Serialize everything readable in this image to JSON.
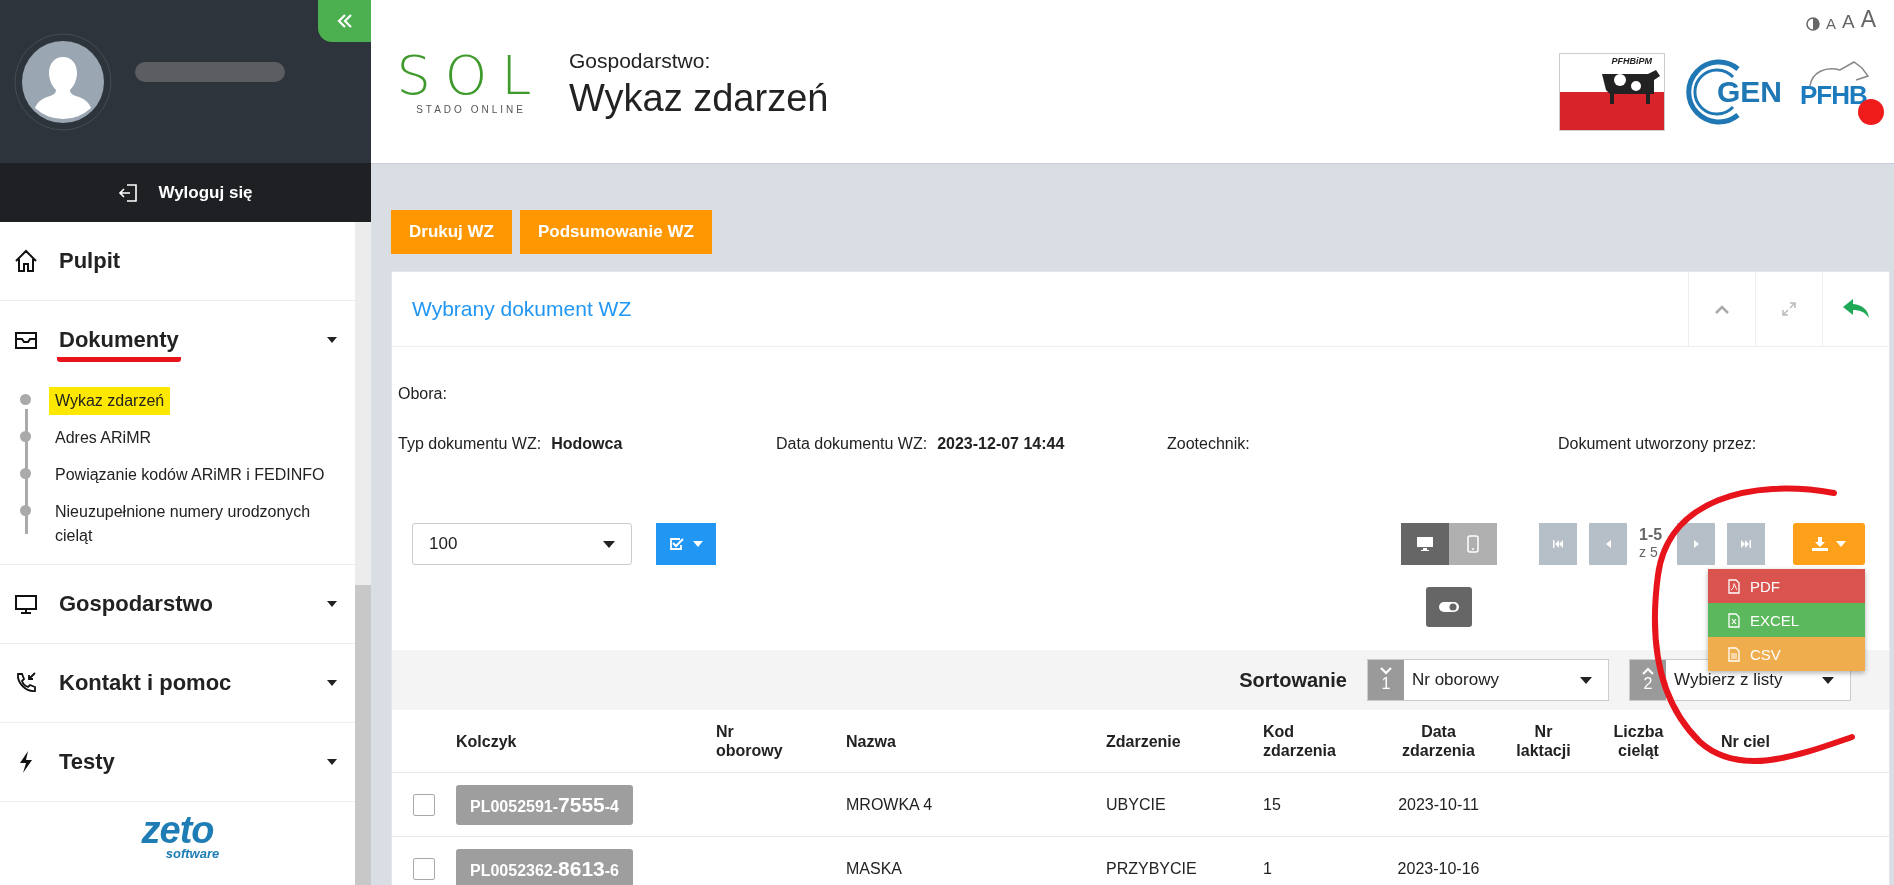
{
  "sidebar": {
    "profile": {
      "name_redacted": true
    },
    "logout": "Wyloguj się",
    "nav": [
      {
        "label": "Pulpit",
        "kind": "home",
        "underlined": false
      },
      {
        "label": "Dokumenty",
        "kind": "inbox",
        "underlined": true,
        "children": [
          {
            "label": "Wykaz zdarzeń",
            "highlighted": true
          },
          {
            "label": "Adres ARiMR",
            "highlighted": false
          },
          {
            "label": "Powiązanie kodów ARiMR i FEDINFO",
            "highlighted": false
          },
          {
            "label": "Nieuzupełnione numery urodzonych cieląt",
            "highlighted": false
          }
        ]
      },
      {
        "label": "Gospodarstwo",
        "kind": "monitor",
        "underlined": false
      },
      {
        "label": "Kontakt i pomoc",
        "kind": "phone",
        "underlined": false
      },
      {
        "label": "Testy",
        "kind": "bolt",
        "underlined": false
      }
    ],
    "footer_logo": {
      "wordmark": "zeto",
      "tagline": "software"
    }
  },
  "header": {
    "logo": {
      "wordmark": "SOL",
      "tagline": "STADO ONLINE"
    },
    "subtitle": "Gospodarstwo:",
    "title": "Wykaz zdarzeń",
    "font_sizes": [
      "A",
      "A",
      "A"
    ],
    "partner_logos": [
      {
        "kind": "pfhbipm",
        "text": "PFHBiPM"
      },
      {
        "kind": "cgen",
        "text": "GEN"
      },
      {
        "kind": "pfhb",
        "text": "PFHB"
      }
    ]
  },
  "actions": [
    "Drukuj WZ",
    "Podsumowanie WZ"
  ],
  "panel": {
    "title": "Wybrany dokument WZ",
    "farm": {
      "label": "Obora:"
    },
    "fields": [
      {
        "label": "Typ dokumentu WZ:",
        "value": "Hodowca"
      },
      {
        "label": "Data dokumentu WZ:",
        "value": "2023-12-07 14:44"
      },
      {
        "label": "Zootechnik:"
      },
      {
        "label": "Dokument utworzony przez:"
      }
    ],
    "page_size": "100",
    "view_modes": [
      {
        "kind": "desktop",
        "selected": true
      },
      {
        "kind": "mobile",
        "selected": false
      }
    ],
    "pagination": {
      "range": "1-5",
      "total": "z 5"
    },
    "export_menu": {
      "open": true,
      "items": [
        {
          "kind": "pdf",
          "label": "PDF",
          "color": "#d9534f"
        },
        {
          "kind": "excel",
          "label": "EXCEL",
          "color": "#5cb85c"
        },
        {
          "kind": "csv",
          "label": "CSV",
          "color": "#f0ad4e"
        }
      ]
    },
    "sort": {
      "label": "Sortowanie",
      "levels": [
        {
          "order": "1",
          "descending": true,
          "value": "Nr oborowy"
        },
        {
          "order": "2",
          "descending": false,
          "placeholder": "Wybierz z listy"
        }
      ]
    },
    "table": {
      "columns": [
        "Kolczyk",
        "Nr oborowy",
        "Nazwa",
        "Zdarzenie",
        "Kod zdarzenia",
        "Data zdarzenia",
        "Nr laktacji",
        "Liczba cieląt",
        "Nr ciel"
      ],
      "rows": [
        {
          "checked": false,
          "tag": {
            "prefix": "PL0052591-",
            "number": "7555",
            "suffix": "-4"
          },
          "name": "MROWKA 4",
          "event": "UBYCIE",
          "code": "15",
          "date": "2023-10-11"
        },
        {
          "checked": false,
          "tag": {
            "prefix": "PL0052362-",
            "number": "8613",
            "suffix": "-6"
          },
          "name": "MASKA",
          "event": "PRZYBYCIE",
          "code": "1",
          "date": "2023-10-16"
        }
      ]
    }
  },
  "annotations": {
    "circle_around_export": true
  }
}
